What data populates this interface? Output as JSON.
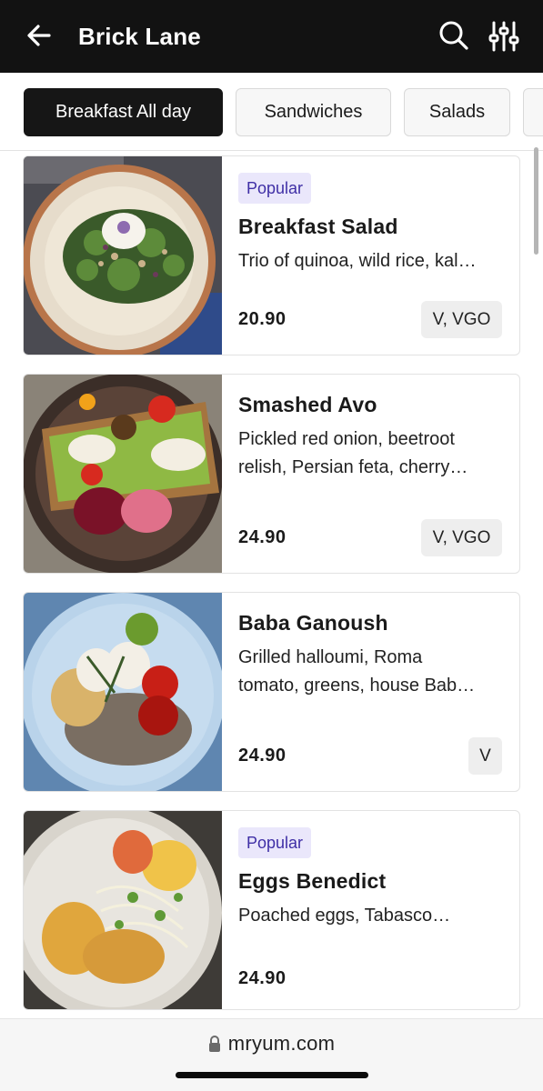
{
  "header": {
    "title": "Brick Lane",
    "back_icon": "arrow-left-icon",
    "search_icon": "search-icon",
    "filter_icon": "sliders-icon"
  },
  "tabs": [
    {
      "label": "Breakfast All day",
      "active": true
    },
    {
      "label": "Sandwiches",
      "active": false
    },
    {
      "label": "Salads",
      "active": false
    }
  ],
  "items": [
    {
      "badge": "Popular",
      "name": "Breakfast Salad",
      "desc_lines": [
        "Trio of quinoa, wild rice, kal…"
      ],
      "price": "20.90",
      "diet": "V, VGO"
    },
    {
      "badge": "",
      "name": "Smashed Avo",
      "desc_lines": [
        "Pickled red onion, beetroot",
        "relish, Persian feta, cherry…"
      ],
      "price": "24.90",
      "diet": "V, VGO"
    },
    {
      "badge": "",
      "name": "Baba Ganoush",
      "desc_lines": [
        "Grilled halloumi, Roma",
        "tomato, greens, house Bab…"
      ],
      "price": "24.90",
      "diet": "V"
    },
    {
      "badge": "Popular",
      "name": "Eggs Benedict",
      "desc_lines": [
        "Poached eggs, Tabasco…"
      ],
      "price": "24.90",
      "diet": ""
    }
  ],
  "browser": {
    "url": "mryum.com",
    "lock_icon": "lock-icon"
  },
  "colors": {
    "header_bg": "#121212",
    "active_tab_bg": "#161616",
    "badge_bg": "#eae7fb",
    "badge_text": "#3f2fa6"
  }
}
